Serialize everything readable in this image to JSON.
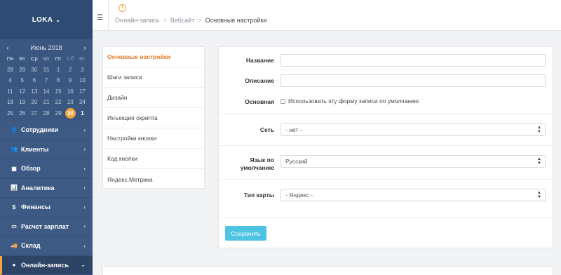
{
  "sidebar": {
    "org_name": "LOKA",
    "calendar": {
      "month_label": "Июнь 2018",
      "prev": "‹",
      "next": "›",
      "weekdays": [
        "Пн",
        "Вт",
        "Ср",
        "Чт",
        "Пт",
        "Сб",
        "Вс"
      ],
      "weeks": [
        [
          "28",
          "29",
          "30",
          "31",
          "1",
          "2",
          "3"
        ],
        [
          "4",
          "5",
          "6",
          "7",
          "8",
          "9",
          "10"
        ],
        [
          "11",
          "12",
          "13",
          "14",
          "15",
          "16",
          "17"
        ],
        [
          "18",
          "19",
          "20",
          "21",
          "22",
          "23",
          "24"
        ],
        [
          "25",
          "26",
          "27",
          "28",
          "29",
          "30",
          "1"
        ]
      ],
      "selected": "30"
    },
    "menu": [
      {
        "label": "Сотрудники",
        "icon": "user-icon",
        "glyph": "👤"
      },
      {
        "label": "Клиенты",
        "icon": "users-icon",
        "glyph": "👥"
      },
      {
        "label": "Обзор",
        "icon": "grid-icon",
        "glyph": "▦"
      },
      {
        "label": "Аналитика",
        "icon": "chart-icon",
        "glyph": "📊"
      },
      {
        "label": "Финансы",
        "icon": "dollar-icon",
        "glyph": "$"
      },
      {
        "label": "Расчет зарплат",
        "icon": "card-icon",
        "glyph": "▭"
      },
      {
        "label": "Склад",
        "icon": "truck-icon",
        "glyph": "🚚"
      },
      {
        "label": "Онлайн-запись",
        "icon": "globe-icon",
        "glyph": "●"
      }
    ]
  },
  "topbar": {
    "info_glyph": "i",
    "breadcrumbs": [
      "Онлайн-запись",
      "Вебсайт",
      "Основные настройки"
    ]
  },
  "tabs": [
    "Основные настройки",
    "Шаги записи",
    "Дизайн",
    "Инъекция скрипта",
    "Настройки кнопки",
    "Код кнопки",
    "Яндекс.Метрика"
  ],
  "form": {
    "name_label": "Название",
    "name_value": "",
    "description_label": "Описание",
    "description_value": "",
    "main_label": "Основная",
    "main_checkbox_label": "Использовать эту форму записи по умолчанию",
    "network_label": "Сеть",
    "network_value": "- нет -",
    "language_label_1": "Язык по",
    "language_label_2": "умолчанию",
    "language_value": "Русский",
    "map_label": "Тип карты",
    "map_value": "- Яндекс -",
    "save_label": "Сохранить"
  },
  "colors": {
    "sidebar": "#3d5a84",
    "accent_orange": "#f3a73b",
    "active_tab": "#e8782c",
    "save_button": "#4ec4e3"
  }
}
